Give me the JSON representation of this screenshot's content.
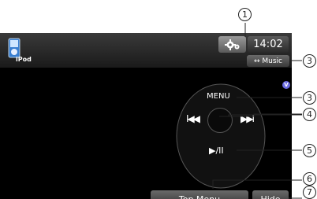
{
  "source": {
    "label": "iPod"
  },
  "status": {
    "time": "14:02"
  },
  "buttons": {
    "music": "↔ Music",
    "top_menu": "Top Menu",
    "hide": "Hide",
    "menu": "MENU",
    "prev": "I◀◀",
    "next": "▶▶I",
    "play_pause": "▶/II"
  },
  "icons": {
    "settings": "gear-icon",
    "volume": "v-icon"
  },
  "callouts": [
    "1",
    "3",
    "3",
    "4",
    "5",
    "6",
    "7"
  ],
  "colors": {
    "screen_bg": "#000000",
    "button_grad_top": "#6a6a6a",
    "button_grad_bottom": "#2f2f2f"
  }
}
